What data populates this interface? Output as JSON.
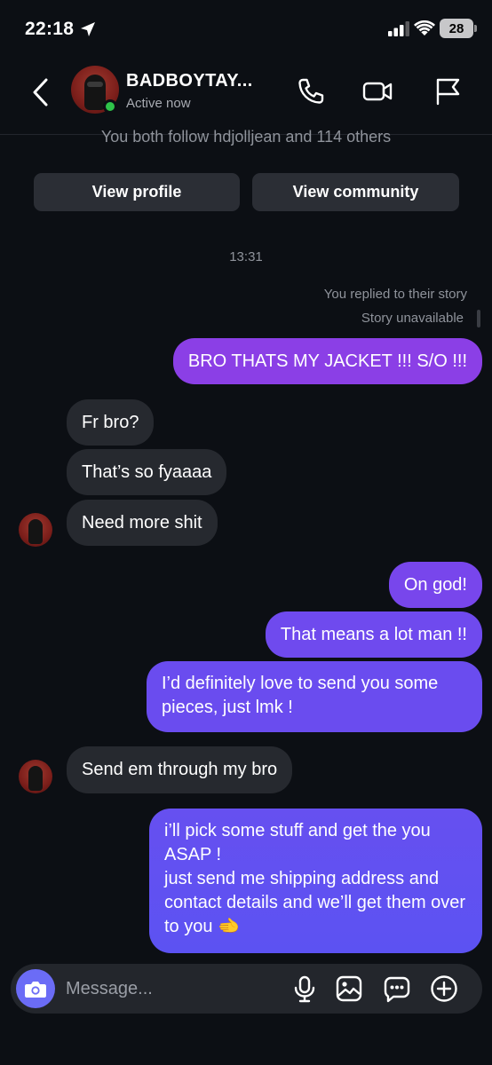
{
  "status_bar": {
    "time": "22:18",
    "battery": "28"
  },
  "header": {
    "name": "BADBOYTAY...",
    "status": "Active now"
  },
  "profile_note": "You both follow hdjolljean and 114 others",
  "profile_buttons": {
    "view_profile": "View profile",
    "view_community": "View community"
  },
  "timestamp": "13:31",
  "story_reply": {
    "replied": "You replied to their story",
    "unavailable": "Story unavailable"
  },
  "messages": [
    {
      "from": "me",
      "text": "BRO THATS MY JACKET !!! S/O !!!"
    },
    {
      "from": "them",
      "text": "Fr bro?"
    },
    {
      "from": "them",
      "text": "That’s so fyaaaa"
    },
    {
      "from": "them",
      "text": "Need more shit"
    },
    {
      "from": "me",
      "text": "On god!"
    },
    {
      "from": "me",
      "text": "That means a lot man !!"
    },
    {
      "from": "me",
      "text": "I’d definitely love to send you some pieces, just lmk !"
    },
    {
      "from": "them",
      "text": "Send em through my bro"
    },
    {
      "from": "me",
      "text": "i’ll pick some stuff and get the you ASAP !\njust send me shipping address and contact details and we’ll get them over to you 🫲"
    }
  ],
  "composer": {
    "placeholder": "Message..."
  },
  "colors": {
    "background": "#0c0f14",
    "incoming_bubble": "#26292f",
    "outgoing_bubble_top": "#8b3fe6",
    "outgoing_bubble_bottom": "#5c52f2",
    "online": "#2fc34a",
    "camera_button": "#6b6cf6"
  },
  "icons": [
    "location-arrow-icon",
    "signal-icon",
    "wifi-icon",
    "battery-icon",
    "back-chevron-icon",
    "phone-icon",
    "video-camera-icon",
    "flag-icon",
    "camera-icon",
    "microphone-icon",
    "gallery-icon",
    "sticker-chat-icon",
    "plus-circle-icon"
  ]
}
